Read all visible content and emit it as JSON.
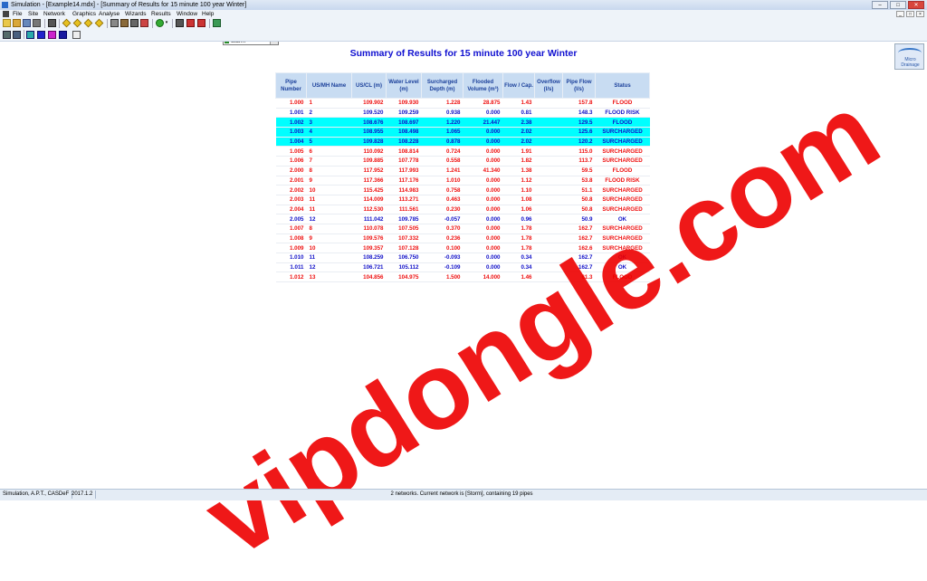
{
  "window": {
    "title": "Simulation - [Example14.mdx] - [Summary of Results for 15 minute 100 year Winter]",
    "buttons": [
      "–",
      "□",
      "✕"
    ]
  },
  "menu": {
    "items": [
      "File",
      "Site",
      "Network",
      "Graphics",
      "Analyse",
      "Wizards",
      "Results",
      "Window",
      "Help"
    ],
    "mdi_buttons": [
      "_",
      "□",
      "×"
    ]
  },
  "toolbar": {
    "network_select": "Storm"
  },
  "logo": {
    "text": "Micro Drainage"
  },
  "report": {
    "title": "Summary of Results for 15 minute 100 year Winter"
  },
  "table": {
    "headers": [
      "Pipe Number",
      "US/MH Name",
      "US/CL (m)",
      "Water Level (m)",
      "Surcharged Depth (m)",
      "Flooded Volume (m³)",
      "Flow / Cap.",
      "Overflow (l/s)",
      "Pipe Flow (l/s)",
      "Status"
    ],
    "rows": [
      {
        "pipe": "1.000",
        "mh": "1",
        "uscl": "109.902",
        "wl": "109.930",
        "sd": "1.228",
        "fv": "28.875",
        "fc": "1.43",
        "of": "",
        "pf": "157.8",
        "status": "FLOOD",
        "tone": "red"
      },
      {
        "pipe": "1.001",
        "mh": "2",
        "uscl": "109.520",
        "wl": "109.259",
        "sd": "0.938",
        "fv": "0.000",
        "fc": "0.81",
        "of": "",
        "pf": "148.3",
        "status": "FLOOD RISK",
        "tone": "blue"
      },
      {
        "pipe": "1.002",
        "mh": "3",
        "uscl": "108.676",
        "wl": "108.697",
        "sd": "1.220",
        "fv": "21.447",
        "fc": "2.38",
        "of": "",
        "pf": "129.5",
        "status": "FLOOD",
        "tone": "hl"
      },
      {
        "pipe": "1.003",
        "mh": "4",
        "uscl": "108.955",
        "wl": "108.498",
        "sd": "1.065",
        "fv": "0.000",
        "fc": "2.02",
        "of": "",
        "pf": "125.6",
        "status": "SURCHARGED",
        "tone": "hl"
      },
      {
        "pipe": "1.004",
        "mh": "5",
        "uscl": "109.828",
        "wl": "108.228",
        "sd": "0.878",
        "fv": "0.000",
        "fc": "2.02",
        "of": "",
        "pf": "120.2",
        "status": "SURCHARGED",
        "tone": "hl"
      },
      {
        "pipe": "1.005",
        "mh": "6",
        "uscl": "110.092",
        "wl": "108.814",
        "sd": "0.724",
        "fv": "0.000",
        "fc": "1.91",
        "of": "",
        "pf": "115.0",
        "status": "SURCHARGED",
        "tone": "red"
      },
      {
        "pipe": "1.006",
        "mh": "7",
        "uscl": "109.885",
        "wl": "107.778",
        "sd": "0.558",
        "fv": "0.000",
        "fc": "1.82",
        "of": "",
        "pf": "113.7",
        "status": "SURCHARGED",
        "tone": "red"
      },
      {
        "pipe": "2.000",
        "mh": "8",
        "uscl": "117.952",
        "wl": "117.993",
        "sd": "1.241",
        "fv": "41.340",
        "fc": "1.38",
        "of": "",
        "pf": "59.5",
        "status": "FLOOD",
        "tone": "red"
      },
      {
        "pipe": "2.001",
        "mh": "9",
        "uscl": "117.366",
        "wl": "117.176",
        "sd": "1.010",
        "fv": "0.000",
        "fc": "1.12",
        "of": "",
        "pf": "53.8",
        "status": "FLOOD RISK",
        "tone": "red"
      },
      {
        "pipe": "2.002",
        "mh": "10",
        "uscl": "115.425",
        "wl": "114.983",
        "sd": "0.758",
        "fv": "0.000",
        "fc": "1.10",
        "of": "",
        "pf": "51.1",
        "status": "SURCHARGED",
        "tone": "red"
      },
      {
        "pipe": "2.003",
        "mh": "11",
        "uscl": "114.009",
        "wl": "113.271",
        "sd": "0.463",
        "fv": "0.000",
        "fc": "1.08",
        "of": "",
        "pf": "50.8",
        "status": "SURCHARGED",
        "tone": "red"
      },
      {
        "pipe": "2.004",
        "mh": "11",
        "uscl": "112.530",
        "wl": "111.561",
        "sd": "0.230",
        "fv": "0.000",
        "fc": "1.06",
        "of": "",
        "pf": "50.8",
        "status": "SURCHARGED",
        "tone": "red"
      },
      {
        "pipe": "2.005",
        "mh": "12",
        "uscl": "111.042",
        "wl": "109.785",
        "sd": "-0.057",
        "fv": "0.000",
        "fc": "0.96",
        "of": "",
        "pf": "50.9",
        "status": "OK",
        "tone": "blue"
      },
      {
        "pipe": "1.007",
        "mh": "8",
        "uscl": "110.078",
        "wl": "107.505",
        "sd": "0.370",
        "fv": "0.000",
        "fc": "1.78",
        "of": "",
        "pf": "162.7",
        "status": "SURCHARGED",
        "tone": "red"
      },
      {
        "pipe": "1.008",
        "mh": "9",
        "uscl": "109.576",
        "wl": "107.332",
        "sd": "0.236",
        "fv": "0.000",
        "fc": "1.78",
        "of": "",
        "pf": "162.7",
        "status": "SURCHARGED",
        "tone": "red"
      },
      {
        "pipe": "1.009",
        "mh": "10",
        "uscl": "109.357",
        "wl": "107.128",
        "sd": "0.100",
        "fv": "0.000",
        "fc": "1.78",
        "of": "",
        "pf": "162.6",
        "status": "SURCHARGED",
        "tone": "red"
      },
      {
        "pipe": "1.010",
        "mh": "11",
        "uscl": "108.259",
        "wl": "106.750",
        "sd": "-0.093",
        "fv": "0.000",
        "fc": "0.34",
        "of": "",
        "pf": "162.7",
        "status": "OK",
        "tone": "blue"
      },
      {
        "pipe": "1.011",
        "mh": "12",
        "uscl": "106.721",
        "wl": "105.112",
        "sd": "-0.109",
        "fv": "0.000",
        "fc": "0.34",
        "of": "",
        "pf": "162.7",
        "status": "OK",
        "tone": "blue"
      },
      {
        "pipe": "1.012",
        "mh": "13",
        "uscl": "104.856",
        "wl": "104.975",
        "sd": "1.500",
        "fv": "14.000",
        "fc": "1.46",
        "of": "",
        "pf": "61.3",
        "status": "FLOOD",
        "tone": "red"
      }
    ]
  },
  "watermark": "vipdongle.com",
  "status": {
    "left": "Simulation, A.P.T., CASDeF",
    "version": "2017.1.2",
    "center": "2 networks.  Current network is [Storm], containing 19 pipes"
  }
}
